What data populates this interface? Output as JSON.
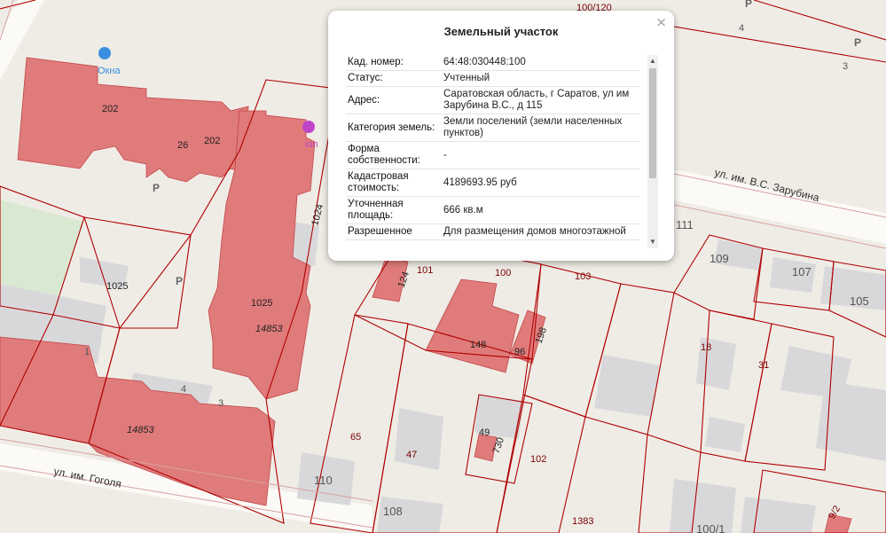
{
  "popup": {
    "title": "Земельный участок",
    "close": "×",
    "rows": [
      {
        "key": "Кад. номер:",
        "value": "64:48:030448:100"
      },
      {
        "key": "Статус:",
        "value": "Учтенный"
      },
      {
        "key": "Адрес:",
        "value": "Саратовская область, г Саратов, ул им Зарубина В.С., д 115"
      },
      {
        "key": "Категория земель:",
        "value": "Земли поселений (земли населенных пунктов)"
      },
      {
        "key": "Форма собственности:",
        "value": "-"
      },
      {
        "key": "Кадастровая стоимость:",
        "value": "4189693.95 руб"
      },
      {
        "key": "Уточненная площадь:",
        "value": "666 кв.м"
      },
      {
        "key": "Разрешенное",
        "value": "Для размещения домов многоэтажной"
      }
    ]
  },
  "map": {
    "streets": [
      "ул. им. В.С. Зарубина",
      "ул. им. Гоголя"
    ],
    "poi": [
      "Окна",
      "ion"
    ],
    "parcel_labels": [
      "100/120",
      "202",
      "26",
      "202",
      "1024",
      "1025",
      "1025",
      "14853",
      "14853",
      "124",
      "101",
      "100",
      "103",
      "148",
      "198",
      "96",
      "65",
      "47",
      "49",
      "730",
      "102",
      "110",
      "108",
      "1383",
      "100/1",
      "111",
      "109",
      "107",
      "105",
      "18",
      "31",
      "9/2",
      "4",
      "3",
      "4",
      "3",
      "1"
    ],
    "colors": {
      "building_cadastre": "#e07b7b",
      "parcel_line": "#b00000",
      "land": "#efece6",
      "building_plain": "#d8d8da",
      "park": "#d9e8d0"
    }
  }
}
